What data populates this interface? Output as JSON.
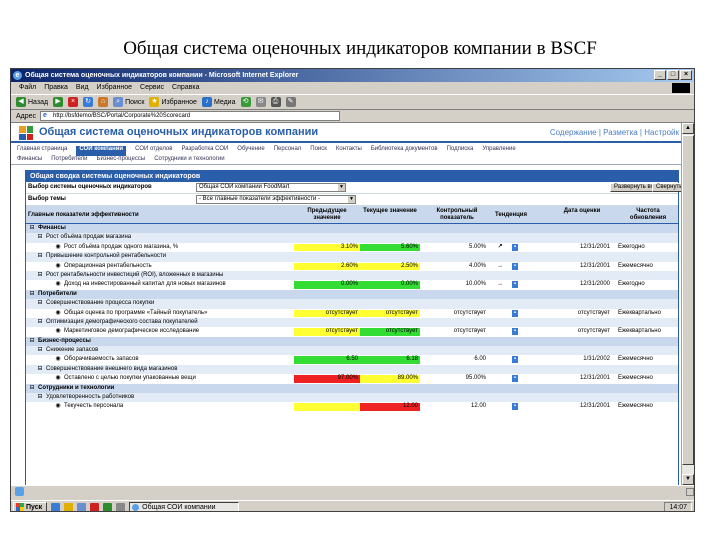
{
  "slide_title": "Общая система оценочных индикаторов компании в BSCF",
  "browser": {
    "window_title": "Общая система оценочных индикаторов компании - Microsoft Internet Explorer",
    "menu": [
      "Файл",
      "Правка",
      "Вид",
      "Избранное",
      "Сервис",
      "Справка"
    ],
    "toolbar": {
      "back": "Назад",
      "search": "Поиск",
      "favorites": "Избранное",
      "media": "Медиа"
    },
    "address_label": "Адрес",
    "address_value": "http://bsfdemo/BSC/Portal/Corporate%20Scorecard"
  },
  "portal": {
    "title": "Общая система оценочных индикаторов компании",
    "head_links": "Содержание | Разметка | Настройк",
    "nav_row1": [
      "Главная страница",
      "СОИ компании",
      "СОИ отделов",
      "Разработка СОИ",
      "Обучение",
      "Персонал",
      "Поиск",
      "Контакты",
      "Библиотека документов",
      "Подписка",
      "Управление"
    ],
    "nav_row1_active": 1,
    "nav_row2": [
      "Финансы",
      "Потребители",
      "Бизнес-процессы",
      "Сотрудники и технологии"
    ]
  },
  "panel": {
    "title": "Общая сводка системы оценочных индикаторов",
    "scorecard_label": "Выбор системы оценочных индикаторов",
    "scorecard_value": "Общая СОИ компании FoodMart",
    "theme_label": "Выбор темы",
    "theme_value": "- Все главные показатели эффективности -",
    "btn_expand": "Развернуть все",
    "btn_collapse": "Свернуть"
  },
  "table_headers": {
    "kpi": "Главные показатели эффективности",
    "prev": "Предыдущее значение",
    "curr": "Текущее значение",
    "target": "Контрольный показатель",
    "trend": "Тенденция",
    "date": "Дата оценки",
    "freq": "Частота обновления"
  },
  "rows": [
    {
      "type": "cat",
      "label": "Финансы"
    },
    {
      "type": "sub",
      "label": "Рост объёма продаж магазина"
    },
    {
      "type": "kpi",
      "label": "Рост объёма продаж одного магазина, %",
      "prev": "3.10%",
      "prev_color": "yellow",
      "curr": "5.60%",
      "curr_color": "green",
      "target": "5.00%",
      "trend": "↗",
      "date": "12/31/2001",
      "freq": "Ежегодно"
    },
    {
      "type": "sub",
      "label": "Привышение контрольной рентабельности"
    },
    {
      "type": "kpi",
      "label": "Операционная рентабельность",
      "prev": "2.60%",
      "prev_color": "yellow",
      "curr": "2.50%",
      "curr_color": "yellow",
      "target": "4.00%",
      "trend": "→",
      "date": "12/31/2001",
      "freq": "Ежемесячно"
    },
    {
      "type": "sub",
      "label": "Рост рентабельности инвестиций (ROI), вложенных в магазины"
    },
    {
      "type": "kpi",
      "label": "Доход на инвестированный капитал для новых магазинов",
      "prev": "0.00%",
      "prev_color": "green",
      "curr": "0.00%",
      "curr_color": "green",
      "target": "10.00%",
      "trend": "→",
      "date": "12/31/2000",
      "freq": "Ежегодно"
    },
    {
      "type": "cat",
      "label": "Потребители"
    },
    {
      "type": "sub",
      "label": "Совершенствование процесса покупки"
    },
    {
      "type": "kpi",
      "label": "Общая оценка по программе «Тайный покупатель»",
      "prev": "отсутствует",
      "prev_color": "yellow",
      "curr": "отсутствует",
      "curr_color": "yellow",
      "target": "отсутствует",
      "trend": "",
      "date": "отсутствует",
      "freq": "Ежеквартально"
    },
    {
      "type": "sub",
      "label": "Оптимизация демографического состава покупателей"
    },
    {
      "type": "kpi",
      "label": "Маркетинговое демографическое исследование",
      "prev": "отсутствует",
      "prev_color": "yellow",
      "curr": "отсутствует",
      "curr_color": "green",
      "target": "отсутствует",
      "trend": "",
      "date": "отсутствует",
      "freq": "Ежеквартально"
    },
    {
      "type": "cat",
      "label": "Бизнес-процессы"
    },
    {
      "type": "sub",
      "label": "Снижение запасов"
    },
    {
      "type": "kpi",
      "label": "Оборачиваемость запасов",
      "prev": "6.50",
      "prev_color": "green",
      "curr": "6.18",
      "curr_color": "green",
      "target": "6.00",
      "trend": "",
      "date": "1/31/2002",
      "freq": "Ежемесячно"
    },
    {
      "type": "sub",
      "label": "Совершенствование внешнего вида магазинов"
    },
    {
      "type": "kpi",
      "label": "Оставлено с целью покупки упакованные вещи",
      "prev": "97.00%",
      "prev_color": "red",
      "curr": "89.00%",
      "curr_color": "yellow",
      "target": "95.00%",
      "trend": "",
      "date": "12/31/2001",
      "freq": "Ежемесячно"
    },
    {
      "type": "cat",
      "label": "Сотрудники и технологии"
    },
    {
      "type": "sub",
      "label": "Удовлетворенность работников"
    },
    {
      "type": "kpi",
      "label": "Текучесть персонала",
      "prev": "",
      "prev_color": "yellow",
      "curr": "12.00",
      "curr_color": "red",
      "target": "12.00",
      "trend": "",
      "date": "12/31/2001",
      "freq": "Ежемесячно"
    }
  ],
  "taskbar": {
    "start": "Пуск",
    "task": "Общая СОИ компании",
    "clock": "14:07"
  },
  "colors": {
    "accent": "#2a5ea8",
    "header_row": "#c9d8ec",
    "sub_row": "#e3ecf6",
    "green": "#33dd33",
    "yellow": "#ffff33",
    "red": "#ee2222"
  }
}
